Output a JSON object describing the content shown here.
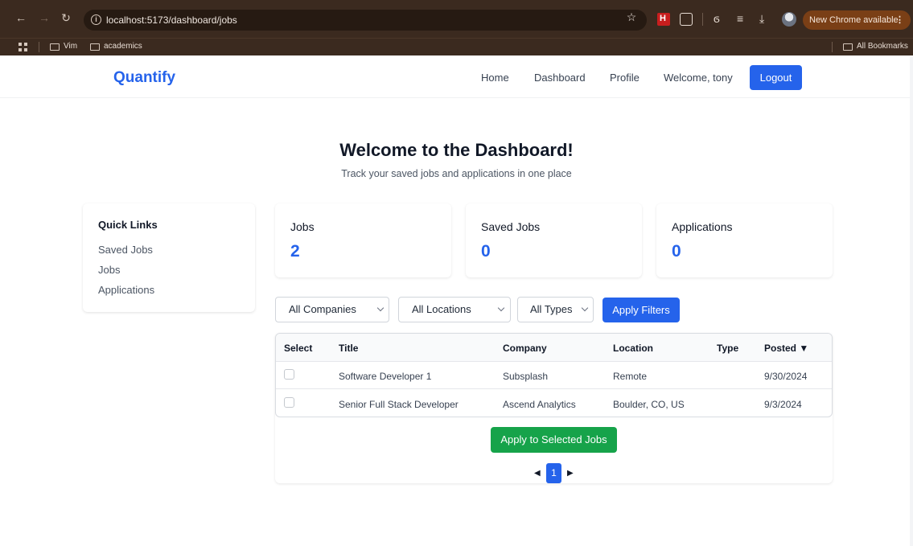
{
  "browser": {
    "url": "localhost:5173/dashboard/jobs",
    "update_label": "New Chrome available",
    "bookmarks": [
      "Vim",
      "academics"
    ],
    "all_bookmarks": "All Bookmarks",
    "icons": [
      "back-icon",
      "forward-icon",
      "reload-icon",
      "info-icon",
      "star-icon",
      "extension-icons",
      "download-icon",
      "profile-avatar",
      "menu-dots-icon"
    ]
  },
  "header": {
    "brand": "Quantify",
    "nav": [
      "Home",
      "Dashboard",
      "Profile"
    ],
    "welcome": "Welcome, tony",
    "logout": "Logout"
  },
  "hero": {
    "title": "Welcome to the Dashboard!",
    "subtitle": "Track your saved jobs and applications in one place"
  },
  "quick_links": {
    "title": "Quick Links",
    "items": [
      "Saved Jobs",
      "Jobs",
      "Applications"
    ]
  },
  "stats": [
    {
      "label": "Jobs",
      "value": "2"
    },
    {
      "label": "Saved Jobs",
      "value": "0"
    },
    {
      "label": "Applications",
      "value": "0"
    }
  ],
  "filters": {
    "company": "All Companies",
    "location": "All Locations",
    "type": "All Types",
    "apply": "Apply Filters"
  },
  "table": {
    "columns": [
      "Select",
      "Title",
      "Company",
      "Location",
      "Type",
      "Posted ▼"
    ],
    "rows": [
      {
        "title": "Software Developer 1",
        "company": "Subsplash",
        "location": "Remote",
        "type": "",
        "posted": "9/30/2024"
      },
      {
        "title": "Senior Full Stack Developer",
        "company": "Ascend Analytics",
        "location": "Boulder, CO, US",
        "type": "",
        "posted": "9/3/2024"
      }
    ]
  },
  "apply_selected": "Apply to Selected Jobs",
  "pagination": {
    "prev": "◀",
    "current": "1",
    "next": "▶"
  },
  "colors": {
    "primary": "#2563eb",
    "success": "#16a34a",
    "chrome": "#3b2a1f"
  }
}
